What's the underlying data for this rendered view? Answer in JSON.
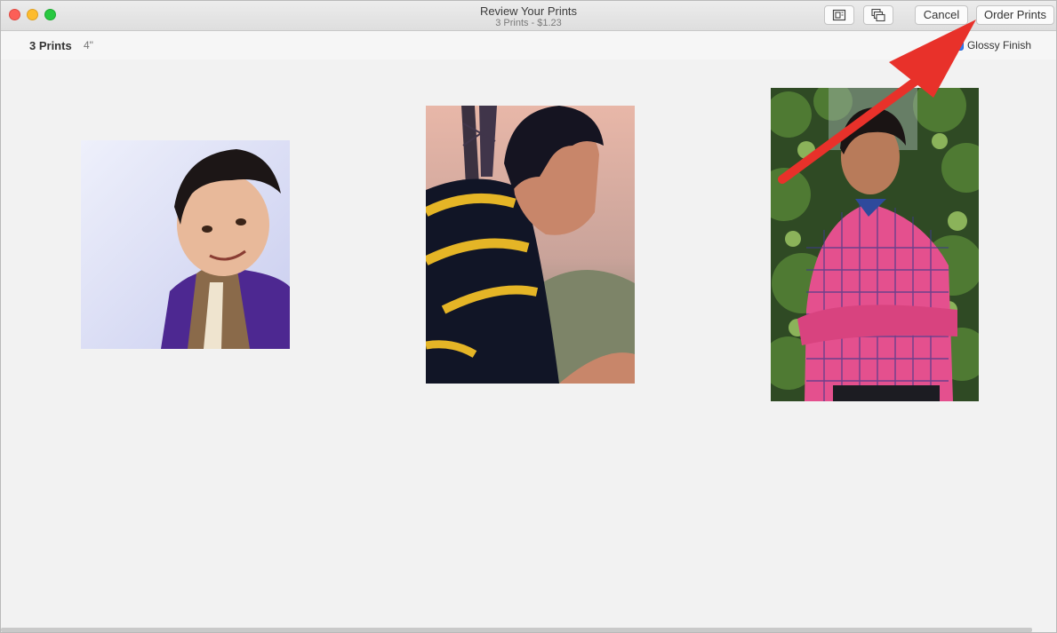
{
  "window": {
    "title": "Review Your Prints",
    "subtitle": "3 Prints - $1.23"
  },
  "toolbar": {
    "layout_icon": "single-layout-icon",
    "multi_icon": "multi-layout-icon",
    "cancel_label": "Cancel",
    "order_label": "Order Prints"
  },
  "options": {
    "print_count": "3 Prints",
    "print_size": "4\"",
    "glossy_label": "Glossy Finish",
    "glossy_checked": true
  },
  "colors": {
    "accent_blue": "#2f7cf6",
    "annotation_arrow": "#e8312a",
    "background": "#f2f2f2"
  },
  "photos": [
    {
      "name": "print-photo-1",
      "subject": "man in purple kurta and brocade vest"
    },
    {
      "name": "print-photo-2",
      "subject": "man in black and yellow striped shirt"
    },
    {
      "name": "print-photo-3",
      "subject": "man in pink checked shirt in front of foliage"
    }
  ]
}
